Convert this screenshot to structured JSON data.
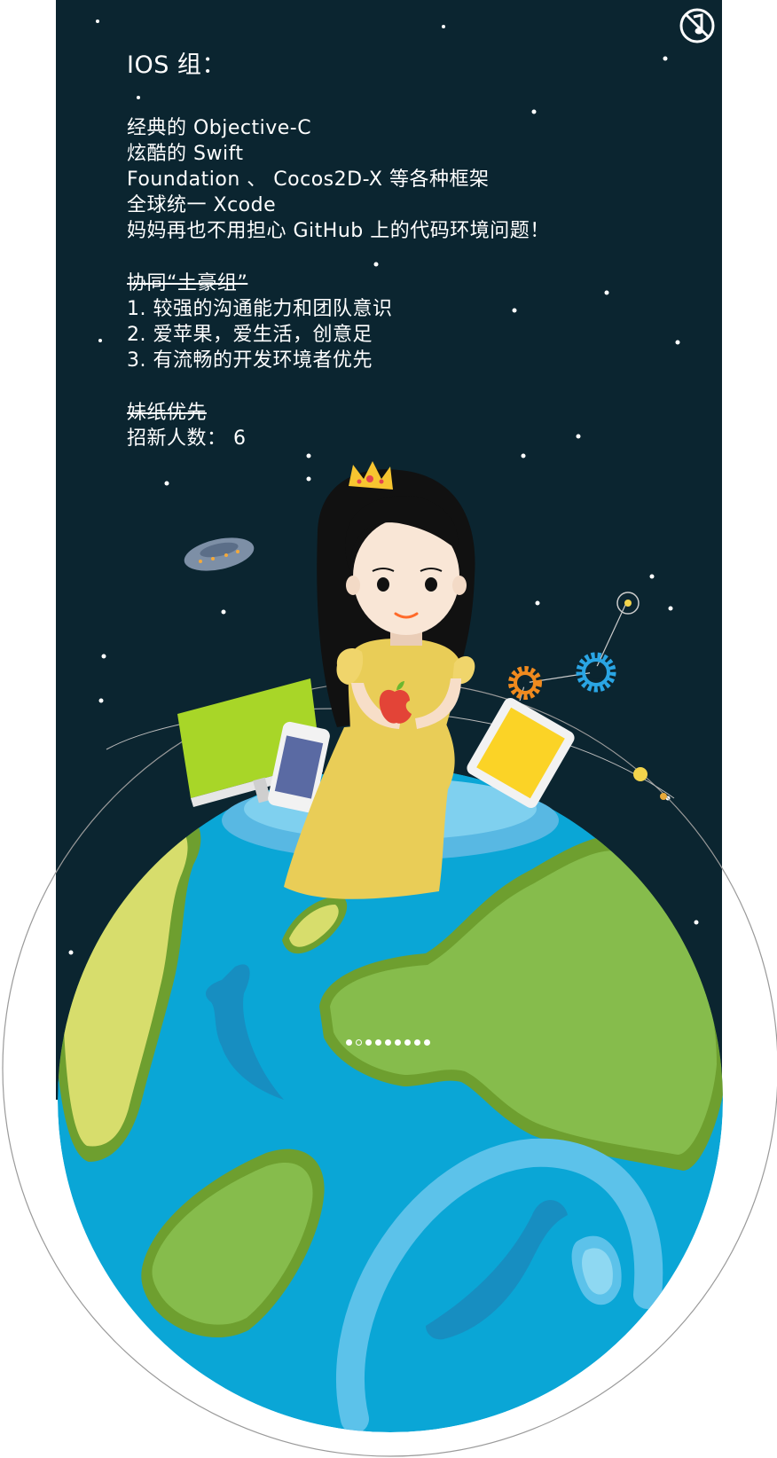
{
  "slide": {
    "heading": "IOS 组：",
    "intro": [
      "经典的 Objective-C",
      "炫酷的 Swift",
      "Foundation 、 Cocos2D-X 等各种框架",
      "全球统一 Xcode",
      "妈妈再也不用担心 GitHub 上的代码环境问题！"
    ],
    "teamwork_title": "协同“土豪组”",
    "requirements": [
      "1. 较强的沟通能力和团队意识",
      "2. 爱苹果，爱生活，创意足",
      "3. 有流畅的开发环境者优先"
    ],
    "sister_note": "妹纸优先",
    "quota": "招新人数： 6"
  },
  "music_button": {
    "icon": "music-off-icon",
    "state": "muted"
  },
  "pager": {
    "total": 9,
    "current": 2
  },
  "colors": {
    "night_sky": "#0b2530",
    "ocean": "#0aa6d6",
    "land": "#86bc4c",
    "land_light": "#d7dd6c",
    "dress": "#e9cd57",
    "crown": "#f7c530",
    "imac": "#a8d628",
    "ipad": "#fbd326",
    "gear_orange": "#f08a1e",
    "gear_blue": "#2aa5e4"
  }
}
